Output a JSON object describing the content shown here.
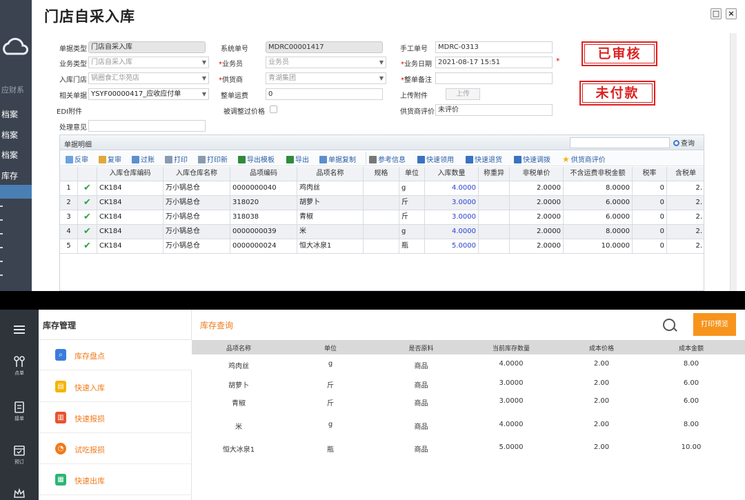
{
  "top_window": {
    "title": "门店自采入库",
    "left_strip": {
      "logo_text": "应财系",
      "labels": [
        "档案",
        "档案",
        "档案",
        "库存"
      ]
    },
    "form": {
      "doc_type_label": "单据类型",
      "doc_type_value": "门店自采入库",
      "system_no_label": "系统单号",
      "system_no_value": "MDRC00001417",
      "manual_no_label": "手工单号",
      "manual_no_value": "MDRC-0313",
      "biz_type_label": "业务类型",
      "biz_type_value": "门店自采入库",
      "salesman_label": "业务员",
      "salesman_value": "业务员",
      "biz_date_label": "业务日期",
      "biz_date_value": "2021-08-17 15:51",
      "store_label": "入库门店",
      "store_value": "锅圈食汇华苑店",
      "supplier_label": "供货商",
      "supplier_value": "青湖集团",
      "remark_label": "整单备注",
      "remark_value": "",
      "related_label": "相关单据",
      "related_value": "YSYF00000417_应收应付单",
      "freight_label": "整单运费",
      "freight_value": "0",
      "upload_label": "上传附件",
      "upload_btn": "上传",
      "edi_label": "EDI附件",
      "adjusted_label": "被调整过价格",
      "supplier_eval_label": "供货商评价",
      "supplier_eval_value": "未评价",
      "opinion_label": "处理意见",
      "opinion_value": ""
    },
    "stamps": {
      "approved": "已审核",
      "unpaid": "未付款"
    },
    "detail": {
      "title": "单据明细",
      "search_btn": "查询",
      "toolbar": {
        "unaudit": "反审",
        "review": "复审",
        "post": "过账",
        "print": "打印",
        "print_new": "打印新",
        "export_template": "导出模板",
        "export": "导出",
        "copy": "单据复制",
        "ref_info": "参考信息",
        "quick_pick": "快速领用",
        "quick_return": "快速退货",
        "quick_transfer": "快速调拨",
        "supplier_eval": "供货商评价"
      },
      "columns": {
        "wh_code": "入库仓库编码",
        "wh_name": "入库仓库名称",
        "item_code": "品项编码",
        "item_name": "品项名称",
        "spec": "规格",
        "unit": "单位",
        "qty": "入库数量",
        "weigh": "称重异",
        "price": "非税单价",
        "amount": "不含运费非税金额",
        "tax": "税率",
        "tax_incl": "含税单"
      },
      "rows": [
        {
          "no": "1",
          "wh_code": "CK184",
          "wh_name": "万小锅总仓",
          "item_code": "0000000040",
          "item_name": "鸡肉丝",
          "unit": "g",
          "qty": "4.0000",
          "price": "2.0000",
          "amount": "8.0000",
          "tax": "0",
          "tax_incl": "2."
        },
        {
          "no": "2",
          "wh_code": "CK184",
          "wh_name": "万小锅总仓",
          "item_code": "318020",
          "item_name": "胡萝卜",
          "unit": "斤",
          "qty": "3.0000",
          "price": "2.0000",
          "amount": "6.0000",
          "tax": "0",
          "tax_incl": "2."
        },
        {
          "no": "3",
          "wh_code": "CK184",
          "wh_name": "万小锅总仓",
          "item_code": "318038",
          "item_name": "青椒",
          "unit": "斤",
          "qty": "3.0000",
          "price": "2.0000",
          "amount": "6.0000",
          "tax": "0",
          "tax_incl": "2."
        },
        {
          "no": "4",
          "wh_code": "CK184",
          "wh_name": "万小锅总仓",
          "item_code": "0000000039",
          "item_name": "米",
          "unit": "g",
          "qty": "4.0000",
          "price": "2.0000",
          "amount": "8.0000",
          "tax": "0",
          "tax_incl": "2."
        },
        {
          "no": "5",
          "wh_code": "CK184",
          "wh_name": "万小锅总仓",
          "item_code": "0000000024",
          "item_name": "恒大冰泉1",
          "unit": "瓶",
          "qty": "5.0000",
          "price": "2.0000",
          "amount": "10.0000",
          "tax": "0",
          "tax_incl": "2."
        }
      ]
    }
  },
  "bottom_window": {
    "rail": [
      {
        "icon": "menu-icon",
        "label": ""
      },
      {
        "icon": "utensils-icon",
        "label": "点单"
      },
      {
        "icon": "clipboard-icon",
        "label": "接单"
      },
      {
        "icon": "calendar-icon",
        "label": "预订"
      }
    ],
    "menu_title": "库存管理",
    "menu_items": [
      {
        "label": "库存盘点",
        "icon": "inventory-check-icon",
        "color": "#3b7ddd"
      },
      {
        "label": "快速入库",
        "icon": "quick-inbound-icon",
        "color": "#f5b400"
      },
      {
        "label": "快速报损",
        "icon": "quick-loss-icon",
        "color": "#e8532d"
      },
      {
        "label": "试吃报损",
        "icon": "tasting-loss-icon",
        "color": "#f07a1a"
      },
      {
        "label": "快速出库",
        "icon": "quick-outbound-icon",
        "color": "#2bb673"
      }
    ],
    "content_title": "库存查询",
    "print_btn": "打印预览",
    "columns": {
      "name": "品项名称",
      "unit": "单位",
      "is_raw": "是否原料",
      "stock": "当前库存数量",
      "cost": "成本价格",
      "amount": "成本金额"
    },
    "rows": [
      {
        "name": "鸡肉丝",
        "unit": "g",
        "is_raw": "商品",
        "stock": "4.0000",
        "cost": "2.00",
        "amount": "8.00"
      },
      {
        "name": "胡萝卜",
        "unit": "斤",
        "is_raw": "商品",
        "stock": "3.0000",
        "cost": "2.00",
        "amount": "6.00"
      },
      {
        "name": "青椒",
        "unit": "斤",
        "is_raw": "商品",
        "stock": "3.0000",
        "cost": "2.00",
        "amount": "6.00"
      },
      {
        "name": "米",
        "unit": "g",
        "is_raw": "商品",
        "stock": "4.0000",
        "cost": "2.00",
        "amount": "8.00"
      },
      {
        "name": "恒大冰泉1",
        "unit": "瓶",
        "is_raw": "商品",
        "stock": "5.0000",
        "cost": "2.00",
        "amount": "10.00"
      }
    ]
  }
}
